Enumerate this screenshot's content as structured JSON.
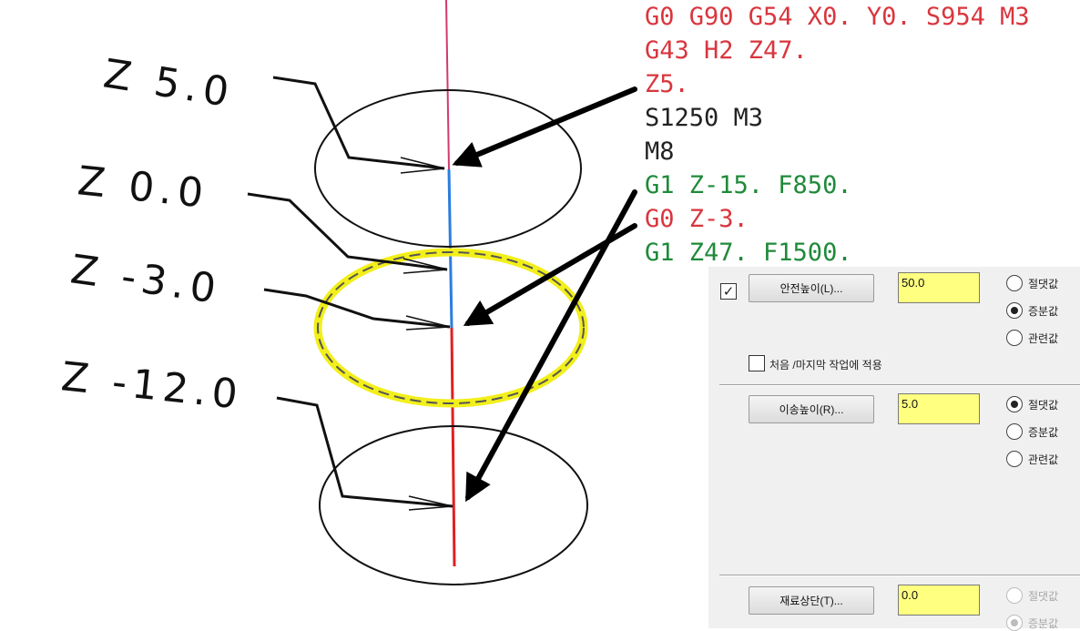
{
  "diagram": {
    "z_labels": [
      "Z 5.0",
      "Z 0.0",
      "Z -3.0",
      "Z -12.0"
    ]
  },
  "code_lines": [
    {
      "text": "G0 G90 G54 X0. Y0. S954 M3",
      "color": "#d9363e"
    },
    {
      "text": "G43 H2 Z47.",
      "color": "#d9363e"
    },
    {
      "text": "Z5.",
      "color": "#d9363e"
    },
    {
      "text": "S1250 M3",
      "color": "#222222"
    },
    {
      "text": "M8",
      "color": "#222222"
    },
    {
      "text": "G1 Z-15. F850.",
      "color": "#1f8a3a"
    },
    {
      "text": "G0 Z-3.",
      "color": "#d9363e"
    },
    {
      "text": "G1 Z47. F1500.",
      "color": "#1f8a3a"
    }
  ],
  "panel": {
    "safe_height": {
      "enabled": true,
      "button": "안전높이(L)...",
      "value": "50.0",
      "options": [
        "절댓값",
        "증분값",
        "관련값"
      ],
      "selected": 1
    },
    "apply_first_last": {
      "checked": false,
      "label": "처음 /마지막 작업에 적용"
    },
    "retract_height": {
      "button": "이송높이(R)...",
      "value": "5.0",
      "options": [
        "절댓값",
        "증분값",
        "관련값"
      ],
      "selected": 0
    },
    "stock_top": {
      "button": "재료상단(T)...",
      "value": "0.0",
      "options": [
        "절댓값",
        "증분값"
      ],
      "selected": 1,
      "disabled": true
    }
  },
  "colors": {
    "code_red": "#d9363e",
    "code_green": "#1f8a3a",
    "field_yellow": "#ffff80",
    "highlight_yellow": "#f2ef1a",
    "tool_blue": "#2b7de0",
    "tool_red": "#e02020"
  }
}
